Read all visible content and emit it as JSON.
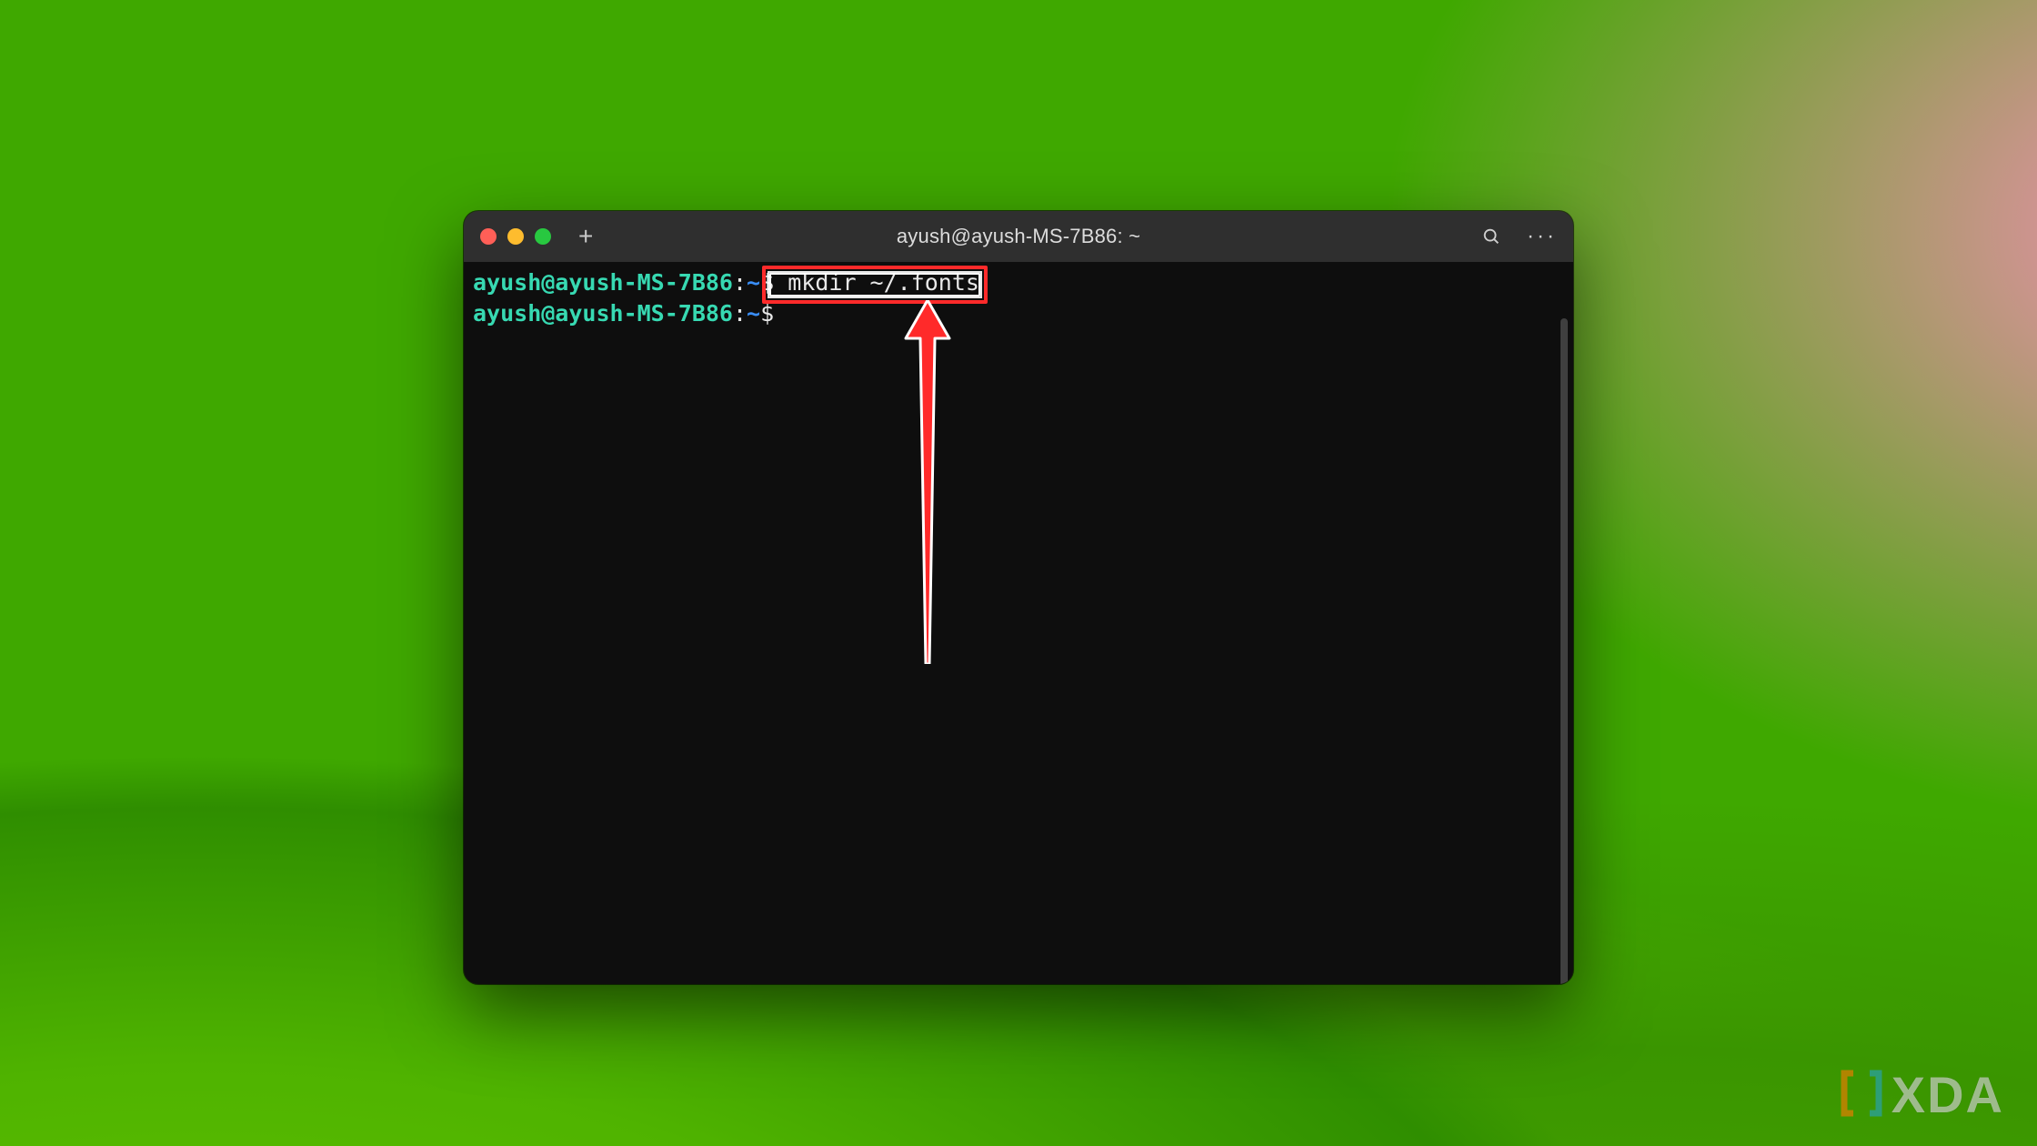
{
  "window": {
    "title": "ayush@ayush-MS-7B86: ~"
  },
  "titlebar_icons": {
    "close": "close-icon",
    "minimize": "minimize-icon",
    "maximize": "maximize-icon",
    "new_tab_label": "+",
    "search": "search-icon",
    "menu": "···"
  },
  "prompt": {
    "user_host": "ayush@ayush-MS-7B86",
    "sep": ":",
    "path": "~",
    "symbol": "$"
  },
  "lines": [
    {
      "command": "mkdir ~/.fonts"
    },
    {
      "command": ""
    }
  ],
  "annotation": {
    "highlight_target": "mkdir ~/.fonts",
    "arrow_color": "#ff2a2a"
  },
  "watermark": {
    "text": "XDA"
  }
}
